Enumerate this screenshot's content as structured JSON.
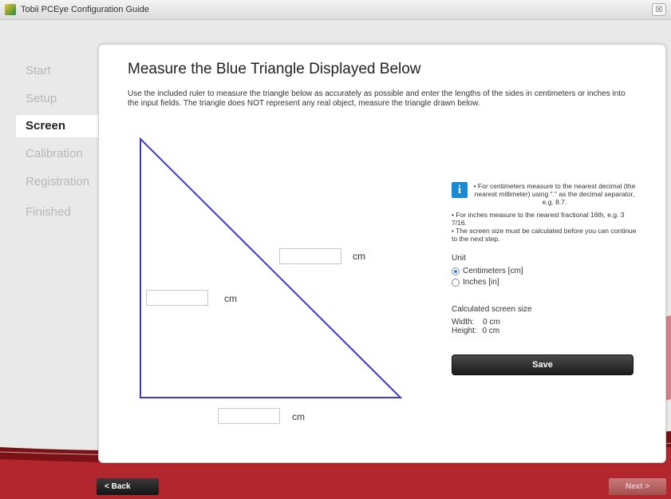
{
  "window": {
    "title": "Tobii PCEye Configuration Guide",
    "close_glyph": "☒"
  },
  "sidebar": {
    "steps": [
      {
        "label": "Start",
        "state": "inactive"
      },
      {
        "label": "Setup",
        "state": "inactive"
      },
      {
        "label": "Screen",
        "state": "active"
      },
      {
        "label": "Calibration",
        "state": "inactive"
      },
      {
        "label": "Registration",
        "state": "inactive"
      },
      {
        "label": "Finished",
        "state": "inactive"
      }
    ]
  },
  "main": {
    "heading": "Measure the Blue Triangle Displayed Below",
    "intro": "Use the included ruler to measure the triangle below as accurately as possible and enter the lengths of the sides in centimeters or inches into the input fields. The triangle does NOT represent any real object, measure the triangle drawn below.",
    "triangle_color": "#3a3ad0",
    "fields": {
      "hypotenuse": {
        "value": "",
        "unit": "cm"
      },
      "vertical": {
        "value": "",
        "unit": "cm"
      },
      "horizontal": {
        "value": "",
        "unit": "cm"
      }
    },
    "info": {
      "line1": "• For centimeters measure to the nearest decimal (the nearest millimeter) using \".\" as the decimal separator, e.g. 8.7.",
      "line2": "• For inches measure to the nearest fractional 16th, e.g. 3 7/16.",
      "line3": "• The screen size must be calculated before you can continue to the next step."
    },
    "unit_selector": {
      "title": "Unit",
      "options": [
        {
          "label": "Centimeters [cm]",
          "selected": true
        },
        {
          "label": "Inches [in]",
          "selected": false
        }
      ]
    },
    "calculated": {
      "title": "Calculated screen size",
      "width_label": "Width:",
      "width_value": "0 cm",
      "height_label": "Height:",
      "height_value": "0 cm"
    },
    "save_label": "Save"
  },
  "footer": {
    "back_label": "< Back",
    "next_label": "Next >"
  },
  "colors": {
    "accent_red": "#b3262d",
    "info_blue": "#1a8bd0"
  }
}
